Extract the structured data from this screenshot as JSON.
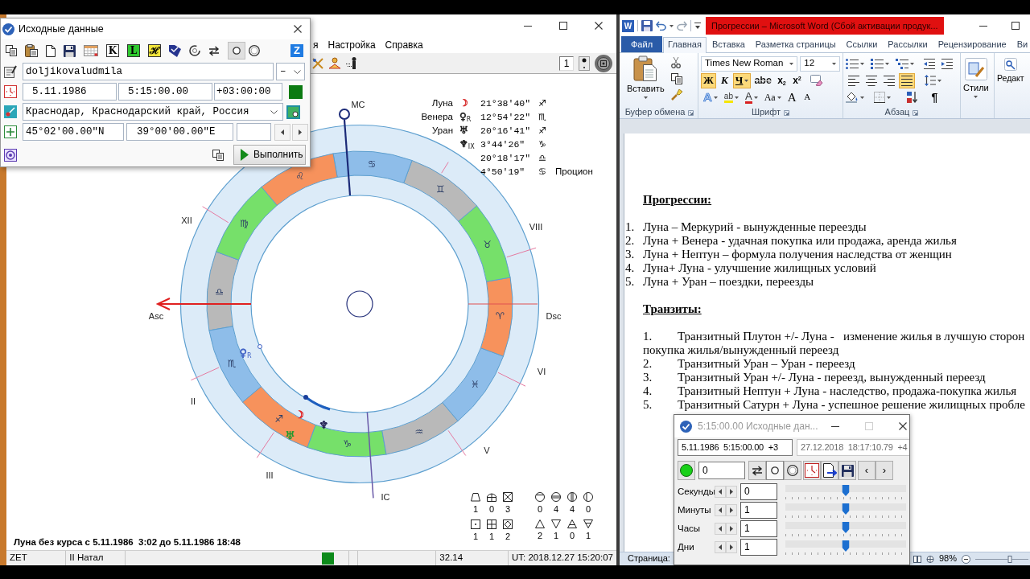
{
  "chart_window": {
    "menu": [
      {
        "label": "я"
      },
      {
        "label": "Настройка"
      },
      {
        "label": "Справка"
      }
    ],
    "toolbar": {
      "page": "1"
    },
    "planets_table": [
      {
        "name": "Луна",
        "glyph": "☽",
        "color": "#d83030",
        "position": "21°38'40\"",
        "sign": "♐"
      },
      {
        "name": "Венера",
        "glyph": "♀",
        "mark": "R",
        "color": "#1a1a1a",
        "position": "12°54'22\"",
        "sign": "♏"
      },
      {
        "name": "Уран",
        "glyph": "♅",
        "color": "#1a1a1a",
        "position": "20°16'41\"",
        "sign": "♐"
      },
      {
        "glyph": "♆",
        "mark": "IX",
        "color": "#1a1a1a",
        "position": "3°44'26\"",
        "sign": "♑"
      },
      {
        "position": "20°18'17\"",
        "sign": "♎"
      },
      {
        "position": "4°50'19\"",
        "sign": "♋",
        "star": "Процион"
      }
    ],
    "wheel": {
      "signs": [
        {
          "glyph": "♎",
          "color": "#b9b9b9"
        },
        {
          "glyph": "♏",
          "color": "#8ebde9"
        },
        {
          "glyph": "♐",
          "color": "#f7925c"
        },
        {
          "glyph": "♑",
          "color": "#76e06a"
        },
        {
          "glyph": "♒",
          "color": "#b9b9b9"
        },
        {
          "glyph": "♓",
          "color": "#8ebde9"
        },
        {
          "glyph": "♈",
          "color": "#f7925c"
        },
        {
          "glyph": "♉",
          "color": "#76e06a"
        },
        {
          "glyph": "♊",
          "color": "#b9b9b9"
        },
        {
          "glyph": "♋",
          "color": "#8ebde9"
        },
        {
          "glyph": "♌",
          "color": "#f7925c"
        },
        {
          "glyph": "♍",
          "color": "#76e06a"
        }
      ],
      "angles": [
        {
          "kind": "mc",
          "label": "MC"
        },
        {
          "kind": "asc",
          "label": "Asc"
        },
        {
          "kind": "dsc",
          "label": "Dsc"
        },
        {
          "kind": "ic",
          "label": "IC"
        }
      ],
      "houses": [
        {
          "label": "XII"
        },
        {
          "label": "VIII"
        },
        {
          "label": "VI"
        },
        {
          "label": "II"
        },
        {
          "label": "V"
        },
        {
          "label": "III"
        }
      ],
      "planets": [
        {
          "glyph": "♀",
          "mark": "R",
          "color": "#3c5fc4"
        },
        {
          "glyph": "☽",
          "color": "#e02424"
        },
        {
          "glyph": "♆",
          "color": "#1e1e50"
        },
        {
          "glyph": "♅",
          "color": "#1f9a2f"
        }
      ]
    },
    "aspects_summary": [
      {
        "cells": [
          {
            "kind": "trapezoid",
            "count": "1"
          },
          {
            "kind": "gable",
            "count": "0"
          },
          {
            "kind": "hourglass",
            "count": "3"
          },
          {
            "kind": "circletop",
            "count": "0"
          },
          {
            "kind": "circlemid",
            "count": "4"
          },
          {
            "kind": "circlebars",
            "count": "4"
          },
          {
            "kind": "circlehalf",
            "count": "0"
          }
        ]
      },
      {
        "cells": [
          {
            "kind": "dotbox",
            "count": "1"
          },
          {
            "kind": "gridbox",
            "count": "1"
          },
          {
            "kind": "diamondbox",
            "count": "2"
          },
          {
            "kind": "fire",
            "count": "2"
          },
          {
            "kind": "water",
            "count": "1"
          },
          {
            "kind": "air",
            "count": "0"
          },
          {
            "kind": "earth",
            "count": "1"
          }
        ]
      }
    ],
    "void_of_course": "Луна без курса с 5.11.1986  3:02 до 5.11.1986 18:48",
    "status_bar": {
      "program": "ZET",
      "mode": "II Натал",
      "value": "32.14",
      "time": "UT: 2018.12.27 15:20:07"
    }
  },
  "data_dialog": {
    "title": "Исходные данные",
    "letter_buttons": [
      {
        "label": "K",
        "color": "#ffffff"
      },
      {
        "label": "L",
        "color": "#2ec82e"
      },
      {
        "label": "ℋ",
        "color": "#f2e53a"
      }
    ],
    "modes": [
      {
        "selected": true
      },
      {
        "selected": false
      }
    ],
    "z_button": "Z",
    "name": "doljikovaludmila",
    "name_kind": "–",
    "date": "5.11.1986",
    "time": "5:15:00.00",
    "zone": "+03:00:00",
    "place": "Краснодар, Краснодарский край, Россия",
    "latitude": "45°02'00.00\"N",
    "longitude": "39°00'00.00\"E",
    "run_button": "Выполнить"
  },
  "word": {
    "logo": "W",
    "title": "Прогрессии – Microsoft Word (Сбой активации продук...",
    "tabs": [
      {
        "label": "Файл",
        "kind": "file",
        "selected": false
      },
      {
        "label": "Главная",
        "kind": "tab",
        "selected": true
      },
      {
        "label": "Вставка",
        "kind": "tab",
        "selected": false
      },
      {
        "label": "Разметка страницы",
        "kind": "tab",
        "selected": false
      },
      {
        "label": "Ссылки",
        "kind": "tab",
        "selected": false
      },
      {
        "label": "Рассылки",
        "kind": "tab",
        "selected": false
      },
      {
        "label": "Рецензирование",
        "kind": "tab",
        "selected": false
      },
      {
        "label": "Ви",
        "kind": "tab",
        "selected": false
      }
    ],
    "clipboard": {
      "paste": "Вставить",
      "group": "Буфер обмена"
    },
    "font": {
      "family": "Times New Roman",
      "size": "12",
      "format": [
        {
          "label": "Ж",
          "kind": "bold",
          "selected": true
        },
        {
          "label": "К",
          "kind": "italic",
          "selected": false
        },
        {
          "label": "Ч",
          "kind": "underline",
          "selected": true
        },
        {
          "label": "abe",
          "kind": "strike",
          "selected": false
        },
        {
          "label": "x$_{2}$",
          "kind": "subscript",
          "selected": false
        },
        {
          "label": "x$^{2}$",
          "kind": "superscript",
          "selected": false
        }
      ],
      "effects": [
        {
          "label": "A",
          "kind": "effects"
        },
        {
          "label": "ab",
          "kind": "highlight"
        },
        {
          "label": "A",
          "kind": "color"
        },
        {
          "label": "Aa",
          "kind": "case"
        },
        {
          "label": "A",
          "kind": "grow"
        },
        {
          "label": "A",
          "kind": "shrink"
        }
      ],
      "group": "Шрифт"
    },
    "paragraph": {
      "align": [
        {
          "kind": "left",
          "selected": false
        },
        {
          "kind": "center",
          "selected": false
        },
        {
          "kind": "right",
          "selected": false
        },
        {
          "kind": "justify",
          "selected": true
        }
      ],
      "marks": "¶",
      "group": "Абзац"
    },
    "styles": "Стили",
    "editing": "Редакт",
    "document": {
      "sections": [
        {
          "heading": "Прогрессии:",
          "kind": "numbered",
          "items": [
            {
              "number": "1.",
              "text": "Луна – Меркурий - вынужденные переезды"
            },
            {
              "number": "2.",
              "text": "Луна + Венера - удачная покупка или продажа, аренда жилья"
            },
            {
              "number": "3.",
              "text": "Луна + Нептун – формула получения наследства от женщин"
            },
            {
              "number": "4.",
              "text": "Луна+ Луна - улучшение жилищных условий"
            },
            {
              "number": "5.",
              "text": "Луна + Уран – поездки, переезды"
            }
          ]
        },
        {
          "heading": "Транзиты:",
          "kind": "tabbed",
          "items": [
            {
              "number": "1.",
              "text": "Транзитный Плутон +/- Луна -   изменение жилья в лучшую сторон",
              "continuation": "покупка жилья/вынужденный переезд"
            },
            {
              "number": "2.",
              "text": "Транзитный Уран – Уран - переезд"
            },
            {
              "number": "3.",
              "text": "Транзитный Уран +/- Луна - переезд, вынужденный переезд"
            },
            {
              "number": "4.",
              "text": "Транзитный Нептун + Луна - наследство, продажа-покупка жилья"
            },
            {
              "number": "5.",
              "text": "Транзитный Сатурн + Луна - успешное решение жилищных пробле"
            }
          ]
        }
      ]
    },
    "status": {
      "page": "Страница:",
      "zoom": "98%",
      "zoom_slider": {
        "level": 0.65
      }
    }
  },
  "progress_dialog": {
    "title": "5:15:00.00 Исходные дан...",
    "fields": [
      {
        "value": "5.11.1986  5:15:00.00  +3",
        "disabled": false
      },
      {
        "value": "27.12.2018  18:17:10.79  +4",
        "disabled": true
      }
    ],
    "step": "0",
    "modes": [
      {
        "selected": true
      },
      {
        "selected": false
      }
    ],
    "prev": "‹",
    "next": "›",
    "rows": [
      {
        "label": "Секунды",
        "value": "0",
        "level": 0.5
      },
      {
        "label": "Минуты",
        "value": "1",
        "level": 0.5
      },
      {
        "label": "Часы",
        "value": "1",
        "level": 0.5
      },
      {
        "label": "Дни",
        "value": "1",
        "level": 0.5
      }
    ]
  }
}
